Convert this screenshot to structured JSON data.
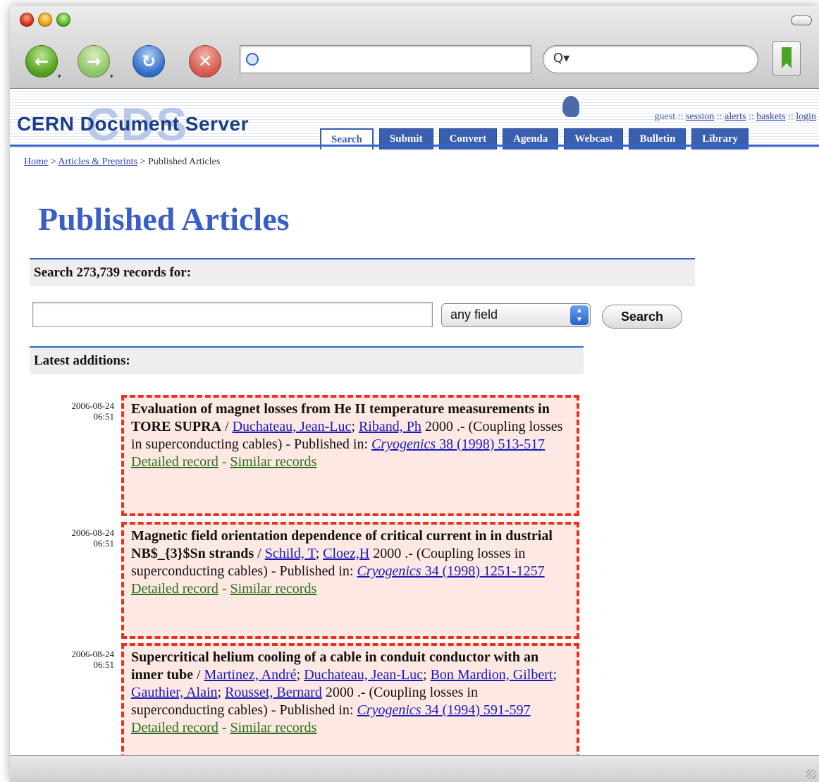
{
  "toolbar": {
    "back_glyph": "←",
    "forward_glyph": "→",
    "reload_glyph": "↻",
    "stop_glyph": "✕",
    "url_value": "",
    "search_value": "",
    "search_glyph": "Q▾"
  },
  "header": {
    "logo_text": "CERN Document Server",
    "logo_watermark": "CDS",
    "user_links": [
      "guest",
      "session",
      "alerts",
      "baskets",
      "login"
    ],
    "separator": "::",
    "tabs": [
      "Search",
      "Submit",
      "Convert",
      "Agenda",
      "Webcast",
      "Bulletin",
      "Library"
    ],
    "active_tab": "Search"
  },
  "breadcrumb": {
    "home": "Home",
    "section": "Articles & Preprints",
    "current": "Published Articles",
    "separator": ">"
  },
  "page": {
    "title": "Published Articles",
    "search_label": "Search 273,739 records for:",
    "search_input_value": "",
    "field_select": "any field",
    "search_button": "Search",
    "latest_label": "Latest additions:"
  },
  "records": [
    {
      "date": "2006-08-24",
      "time": "06:51",
      "title": "Evaluation of magnet losses from He II temperature measurements in TORE SUPRA",
      "authors": [
        "Duchateau, Jean-Luc",
        "Riband, Ph"
      ],
      "year_note": " 2000 .- (Coupling losses in superconducting cables) - Published in: ",
      "journal": "Cryogenics",
      "journal_ref": " 38 (1998) 513-517",
      "detailed": "Detailed record",
      "similar": "Similar records"
    },
    {
      "date": "2006-08-24",
      "time": "06:51",
      "title": "Magnetic field orientation dependence of critical current in in dustrial NB$_{3}$Sn strands",
      "authors": [
        "Schild, T",
        "Cloez,H"
      ],
      "year_note": " 2000 .- (Coupling losses in superconducting cables) - Published in: ",
      "journal": "Cryogenics",
      "journal_ref": " 34 (1998) 1251-1257",
      "detailed": "Detailed record",
      "similar": "Similar records"
    },
    {
      "date": "2006-08-24",
      "time": "06:51",
      "title": "Supercritical helium cooling of a cable in conduit conductor with an inner tube",
      "authors": [
        "Martinez, André",
        "Duchateau, Jean-Luc",
        "Bon Mardion, Gilbert",
        "Gauthier, Alain",
        "Rousset, Bernard"
      ],
      "year_note": " 2000 .- (Coupling losses in superconducting cables) - Published in: ",
      "journal": "Cryogenics",
      "journal_ref": " 34 (1994) 591-597",
      "detailed": "Detailed record",
      "similar": "Similar records"
    }
  ],
  "colors": {
    "accent": "#3366cc",
    "title": "#3a5fc4",
    "highlight_bg": "#fde8e4",
    "highlight_border": "#e8321e",
    "link": "#1a1ab8",
    "action_link": "#2c6e1a"
  }
}
